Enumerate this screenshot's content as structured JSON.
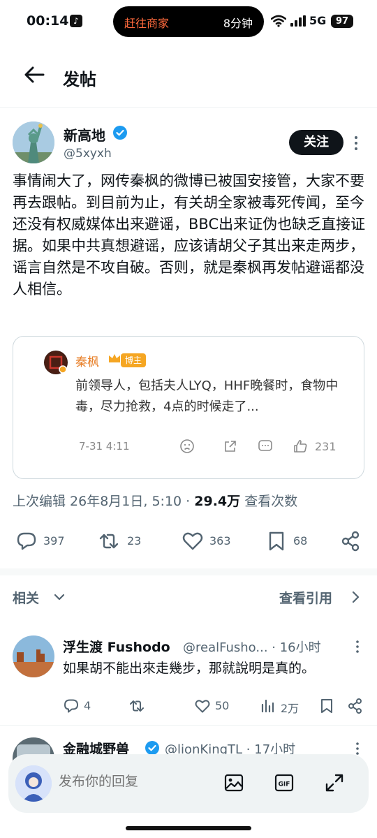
{
  "status_bar": {
    "time": "00:14",
    "app_icon": "tiktok-icon",
    "island_left": "赶往商家",
    "island_right": "8分钟",
    "network": "5G",
    "battery": "97"
  },
  "header": {
    "title": "发帖",
    "back_icon": "arrow-left-icon"
  },
  "post": {
    "author_name": "新高地",
    "author_handle": "@5xyxh",
    "follow_label": "关注",
    "text": "事情闹大了，网传秦枫的微博已被国安接管，大家不要再去跟帖。到目前为止，有关胡全家被毒死传闻，至今还没有权威媒体出来避谣，BBC出来证伪也缺乏直接证据。如果中共真想避谣，应该请胡父子其出来走两步，谣言自然是不攻自破。否则，就是秦枫再发帖避谣都没人相信。",
    "quote": {
      "author": "秦枫",
      "badge": "博主",
      "text": "前领导人，包括夫人LYQ，HHF晚餐时，食物中毒，尽力抢救，4点的时候走了...",
      "date": "7-31 4:11",
      "likes": "231"
    },
    "meta": {
      "edited": "上次编辑 26年8月1日, 5:10 · ",
      "views": "29.4万",
      "views_label": " 查看次数"
    },
    "actions": {
      "replies": "397",
      "reposts": "23",
      "likes": "363",
      "bookmarks": "68"
    }
  },
  "related": {
    "label": "相关",
    "quotes_link": "查看引用"
  },
  "replies": [
    {
      "name": "浮生渡 Fushodo",
      "handle": "@realFusho... · 16小时",
      "text": "如果胡不能出來走幾步，那就說明是真的。",
      "replies": "4",
      "likes": "50",
      "views": "2万"
    },
    {
      "name": "金融城野兽",
      "handle": "@lionKingTL · 17小时"
    }
  ],
  "composer": {
    "placeholder": "发布你的回复"
  },
  "colors": {
    "text": "#0f1419",
    "secondary": "#536471",
    "verified": "#1d9bf0",
    "weibo_orange": "#e8812b"
  }
}
